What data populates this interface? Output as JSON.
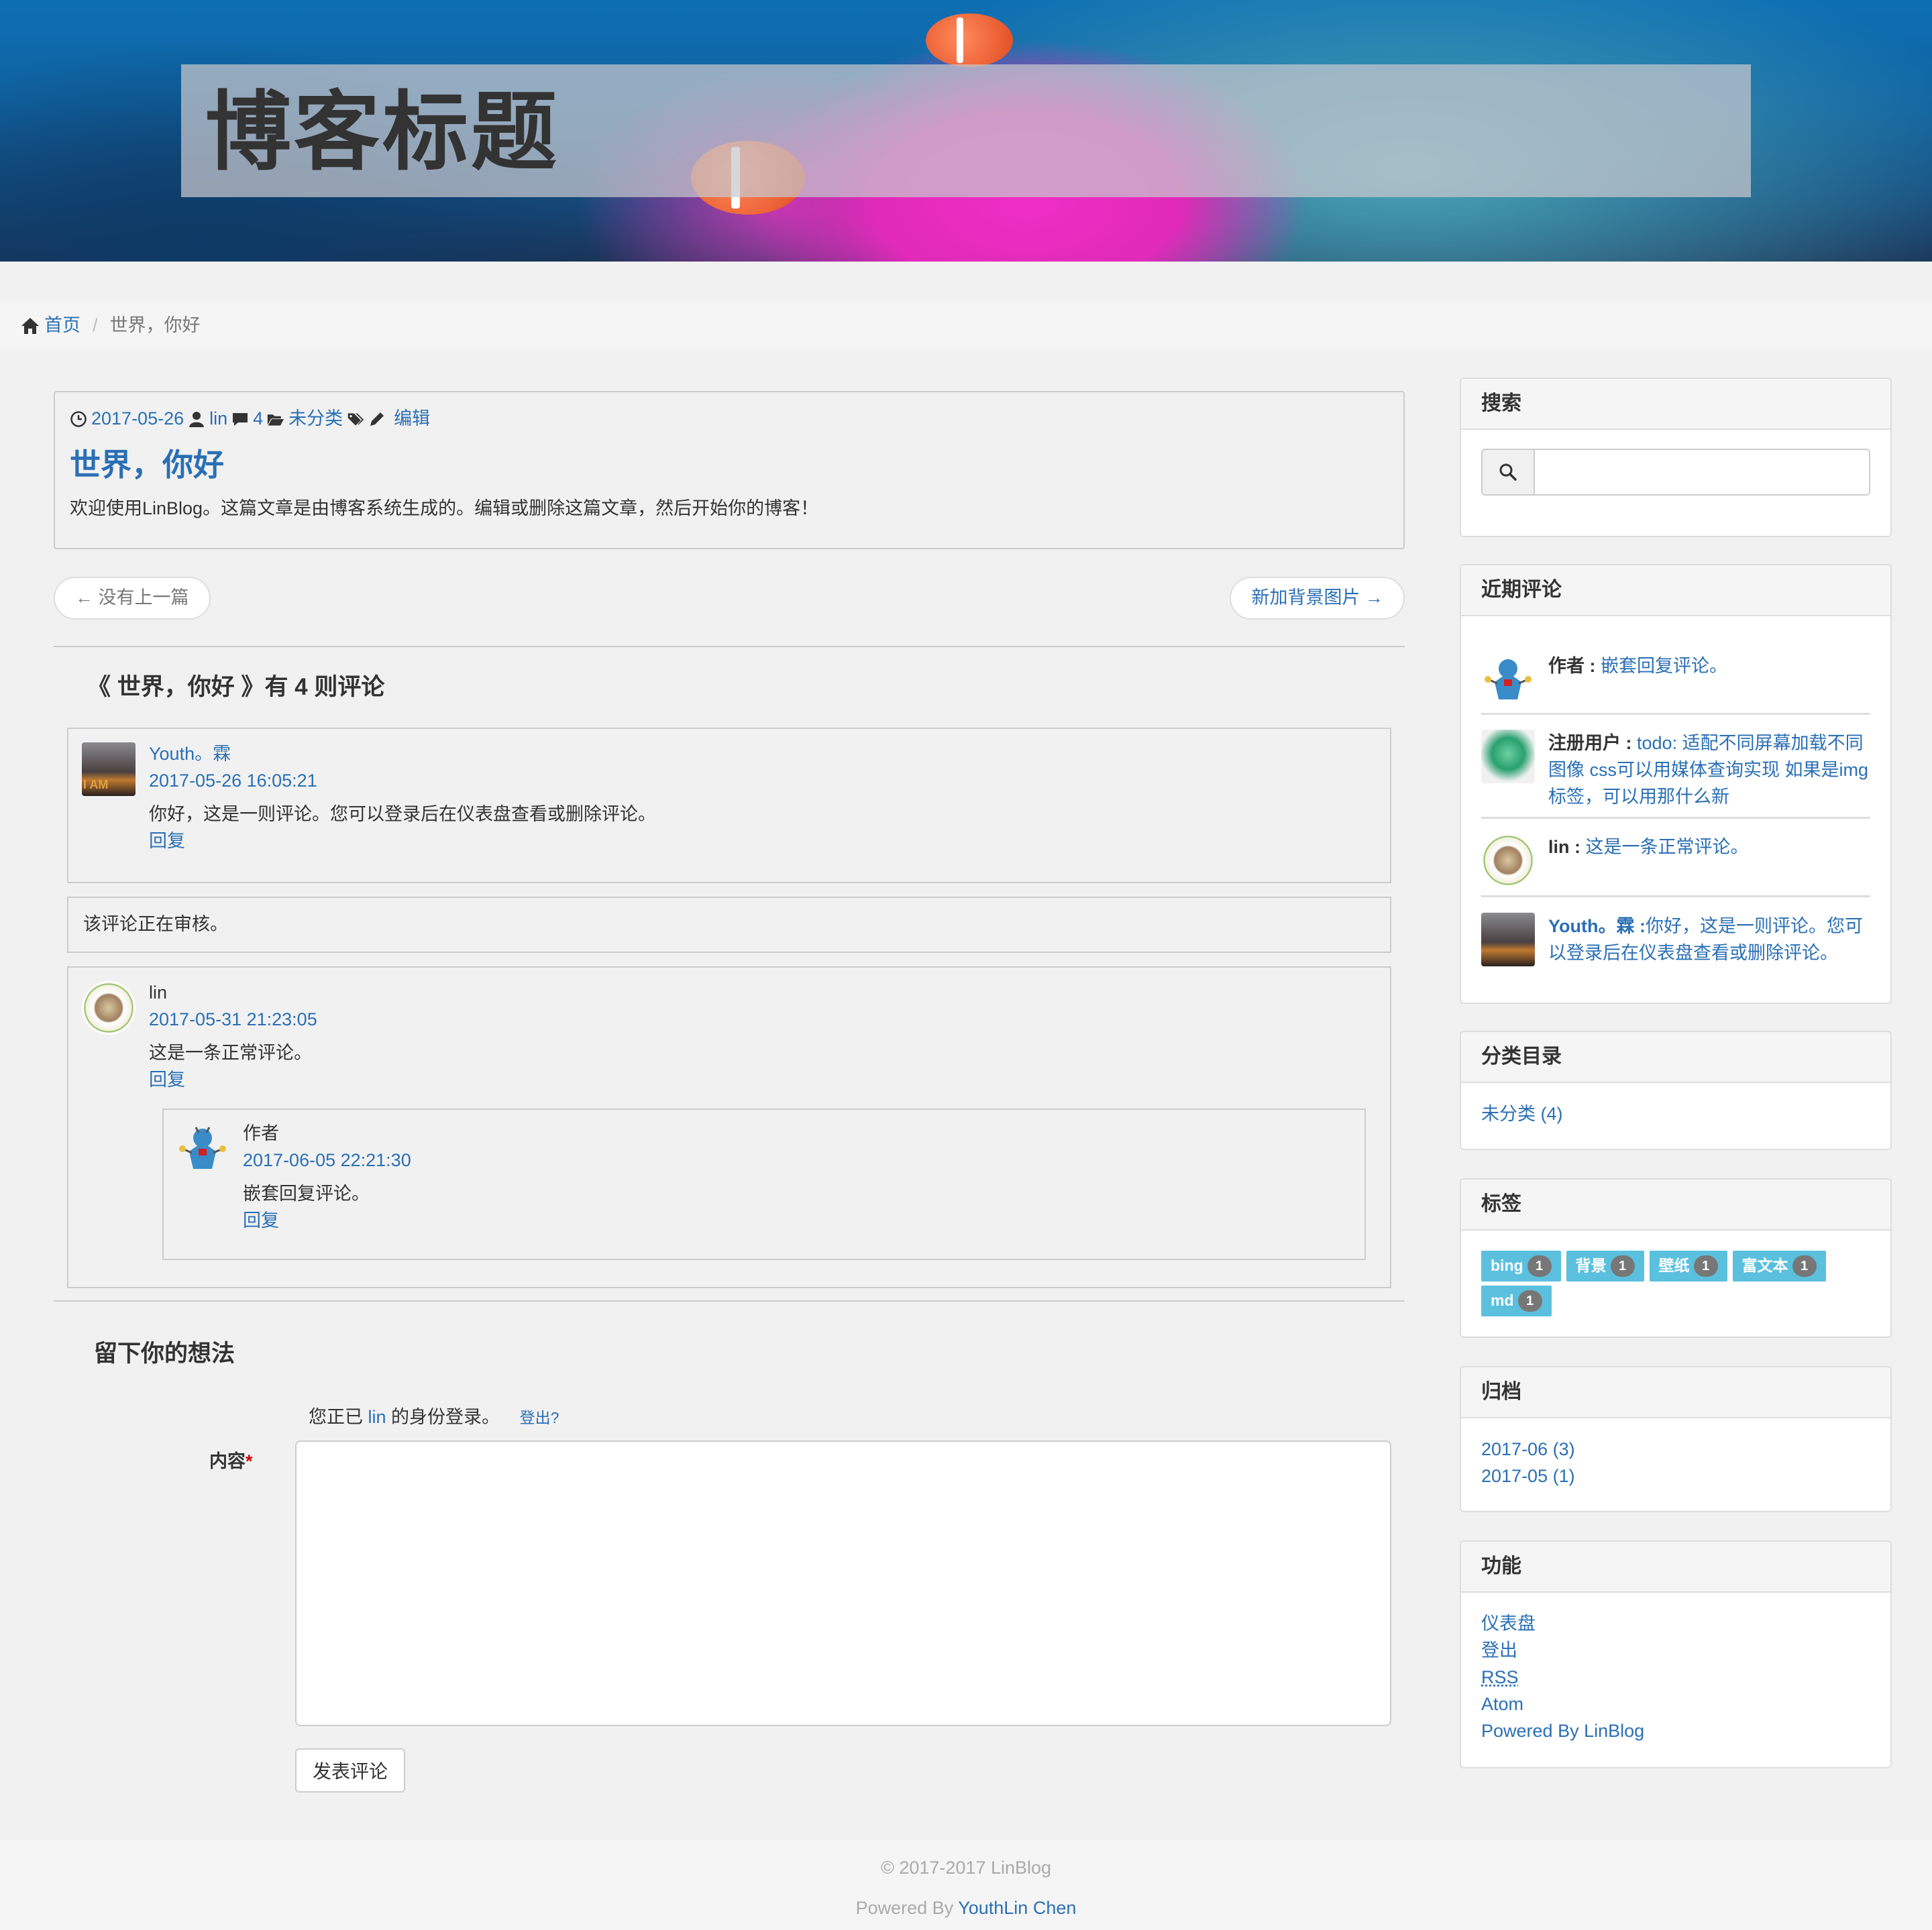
{
  "header": {
    "blog_title": "博客标题"
  },
  "breadcrumb": {
    "home": "首页",
    "current": "世界，你好"
  },
  "post": {
    "date": "2017-05-26",
    "author": "lin",
    "comment_count": "4",
    "category": "未分类",
    "edit": "编辑",
    "title": "世界，你好",
    "content": "欢迎使用LinBlog。这篇文章是由博客系统生成的。编辑或删除这篇文章，然后开始你的博客！"
  },
  "pager": {
    "prev": "← 没有上一篇",
    "next": "新加背景图片 →"
  },
  "comments": {
    "heading": "《 世界，你好 》有 4 则评论",
    "items": [
      {
        "author": "Youth。霖",
        "date": "2017-05-26 16:05:21",
        "text": "你好，这是一则评论。您可以登录后在仪表盘查看或删除评论。",
        "reply": "回复"
      },
      {
        "moderation": "该评论正在审核。"
      },
      {
        "author": "lin",
        "date": "2017-05-31 21:23:05",
        "text": "这是一条正常评论。",
        "reply": "回复",
        "child": {
          "author": "作者",
          "date": "2017-06-05 22:21:30",
          "text": "嵌套回复评论。",
          "reply": "回复"
        }
      }
    ]
  },
  "reply_form": {
    "heading": "留下你的想法",
    "logged_prefix": "您正已",
    "logged_user": "lin",
    "logged_suffix": "的身份登录。",
    "logout": "登出?",
    "content_label": "内容",
    "required_mark": "*",
    "content_value": "",
    "submit": "发表评论"
  },
  "sidebar": {
    "search": {
      "title": "搜索",
      "value": ""
    },
    "recent_comments": {
      "title": "近期评论",
      "items": [
        {
          "author": "作者 :",
          "text": "嵌套回复评论。"
        },
        {
          "author": "注册用户 :",
          "text": "todo: 适配不同屏幕加载不同图像 css可以用媒体查询实现 如果是img 标签，可以用那什么新"
        },
        {
          "author": "lin :",
          "text": "这是一条正常评论。"
        },
        {
          "author": "Youth。霖 :",
          "text": "你好，这是一则评论。您可以登录后在仪表盘查看或删除评论。"
        }
      ]
    },
    "categories": {
      "title": "分类目录",
      "items": [
        "未分类 (4)"
      ]
    },
    "tags": {
      "title": "标签",
      "items": [
        {
          "name": "bing",
          "count": "1"
        },
        {
          "name": "背景",
          "count": "1"
        },
        {
          "name": "壁纸",
          "count": "1"
        },
        {
          "name": "富文本",
          "count": "1"
        },
        {
          "name": "md",
          "count": "1"
        }
      ]
    },
    "archives": {
      "title": "归档",
      "items": [
        "2017-06 (3)",
        "2017-05 (1)"
      ]
    },
    "functions": {
      "title": "功能",
      "items": [
        "仪表盘",
        "登出",
        "RSS",
        "Atom",
        "Powered By LinBlog"
      ]
    }
  },
  "footer": {
    "copyright": "© 2017-2017 LinBlog",
    "powered_prefix": "Powered By",
    "powered_name": "YouthLin Chen"
  },
  "colors": {
    "link": "#2a6fb5",
    "tag": "#5bc0de",
    "badge": "#777777"
  }
}
